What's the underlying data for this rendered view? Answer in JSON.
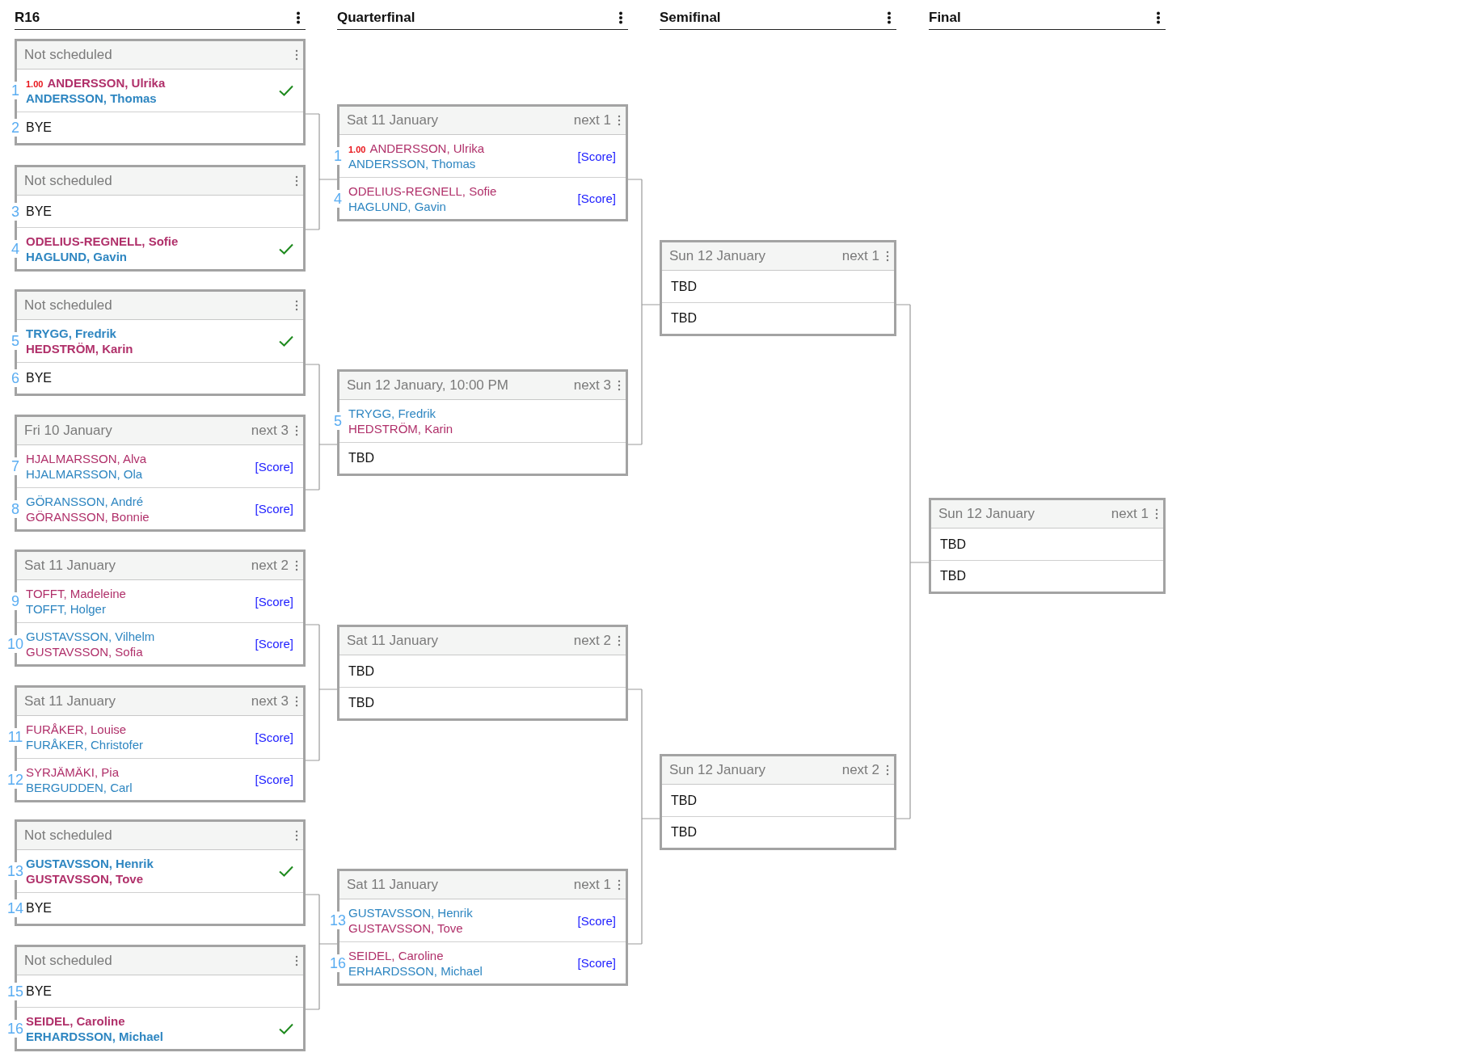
{
  "columns": [
    {
      "title": "R16",
      "matches": [
        {
          "date": "Not scheduled",
          "entries": [
            {
              "kind": "team",
              "seed": "1",
              "rating": "1.00",
              "winner": true,
              "players": [
                {
                  "name": "ANDERSSON, Ulrika",
                  "color": "#b0306a"
                },
                {
                  "name": "ANDERSSON, Thomas",
                  "color": "#2e86c1"
                }
              ]
            },
            {
              "kind": "bye",
              "seed": "2",
              "label": "BYE"
            }
          ]
        },
        {
          "date": "Not scheduled",
          "entries": [
            {
              "kind": "bye",
              "seed": "3",
              "label": "BYE"
            },
            {
              "kind": "team",
              "seed": "4",
              "winner": true,
              "players": [
                {
                  "name": "ODELIUS-REGNELL, Sofie",
                  "color": "#b0306a"
                },
                {
                  "name": "HAGLUND, Gavin",
                  "color": "#2e86c1"
                }
              ]
            }
          ]
        },
        {
          "date": "Not scheduled",
          "entries": [
            {
              "kind": "team",
              "seed": "5",
              "winner": true,
              "players": [
                {
                  "name": "TRYGG, Fredrik",
                  "color": "#2e86c1"
                },
                {
                  "name": "HEDSTRÖM, Karin",
                  "color": "#b0306a"
                }
              ]
            },
            {
              "kind": "bye",
              "seed": "6",
              "label": "BYE"
            }
          ]
        },
        {
          "date": "Fri 10 January",
          "next": "next 3",
          "entries": [
            {
              "kind": "team",
              "seed": "7",
              "winner": false,
              "score": "[Score]",
              "players": [
                {
                  "name": "HJALMARSSON, Alva",
                  "color": "#b0306a"
                },
                {
                  "name": "HJALMARSSON, Ola",
                  "color": "#2e86c1"
                }
              ]
            },
            {
              "kind": "team",
              "seed": "8",
              "winner": false,
              "score": "[Score]",
              "players": [
                {
                  "name": "GÖRANSSON, André",
                  "color": "#2e86c1"
                },
                {
                  "name": "GÖRANSSON, Bonnie",
                  "color": "#b0306a"
                }
              ]
            }
          ]
        },
        {
          "date": "Sat 11 January",
          "next": "next 2",
          "entries": [
            {
              "kind": "team",
              "seed": "9",
              "winner": false,
              "score": "[Score]",
              "players": [
                {
                  "name": "TOFFT, Madeleine",
                  "color": "#b0306a"
                },
                {
                  "name": "TOFFT, Holger",
                  "color": "#2e86c1"
                }
              ]
            },
            {
              "kind": "team",
              "seed": "10",
              "winner": false,
              "score": "[Score]",
              "players": [
                {
                  "name": "GUSTAVSSON, Vilhelm",
                  "color": "#2e86c1"
                },
                {
                  "name": "GUSTAVSSON, Sofia",
                  "color": "#b0306a"
                }
              ]
            }
          ]
        },
        {
          "date": "Sat 11 January",
          "next": "next 3",
          "entries": [
            {
              "kind": "team",
              "seed": "11",
              "winner": false,
              "score": "[Score]",
              "players": [
                {
                  "name": "FURÅKER, Louise",
                  "color": "#b0306a"
                },
                {
                  "name": "FURÅKER, Christofer",
                  "color": "#2e86c1"
                }
              ]
            },
            {
              "kind": "team",
              "seed": "12",
              "winner": false,
              "score": "[Score]",
              "players": [
                {
                  "name": "SYRJÄMÄKI, Pia",
                  "color": "#b0306a"
                },
                {
                  "name": "BERGUDDEN, Carl",
                  "color": "#2e86c1"
                }
              ]
            }
          ]
        },
        {
          "date": "Not scheduled",
          "entries": [
            {
              "kind": "team",
              "seed": "13",
              "winner": true,
              "players": [
                {
                  "name": "GUSTAVSSON, Henrik",
                  "color": "#2e86c1"
                },
                {
                  "name": "GUSTAVSSON, Tove",
                  "color": "#b0306a"
                }
              ]
            },
            {
              "kind": "bye",
              "seed": "14",
              "label": "BYE"
            }
          ]
        },
        {
          "date": "Not scheduled",
          "entries": [
            {
              "kind": "bye",
              "seed": "15",
              "label": "BYE"
            },
            {
              "kind": "team",
              "seed": "16",
              "winner": true,
              "players": [
                {
                  "name": "SEIDEL, Caroline",
                  "color": "#b0306a"
                },
                {
                  "name": "ERHARDSSON, Michael",
                  "color": "#2e86c1"
                }
              ]
            }
          ]
        }
      ]
    },
    {
      "title": "Quarterfinal",
      "matches": [
        {
          "date": "Sat 11 January",
          "next": "next 1",
          "entries": [
            {
              "kind": "team",
              "seed": "1",
              "rating": "1.00",
              "winner": false,
              "score": "[Score]",
              "players": [
                {
                  "name": "ANDERSSON, Ulrika",
                  "color": "#b0306a"
                },
                {
                  "name": "ANDERSSON, Thomas",
                  "color": "#2e86c1"
                }
              ]
            },
            {
              "kind": "team",
              "seed": "4",
              "winner": false,
              "score": "[Score]",
              "players": [
                {
                  "name": "ODELIUS-REGNELL, Sofie",
                  "color": "#b0306a"
                },
                {
                  "name": "HAGLUND, Gavin",
                  "color": "#2e86c1"
                }
              ]
            }
          ]
        },
        {
          "date": "Sun 12 January, 10:00 PM",
          "next": "next 3",
          "entries": [
            {
              "kind": "team",
              "seed": "5",
              "winner": false,
              "players": [
                {
                  "name": "TRYGG, Fredrik",
                  "color": "#2e86c1"
                },
                {
                  "name": "HEDSTRÖM, Karin",
                  "color": "#b0306a"
                }
              ]
            },
            {
              "kind": "tbd",
              "label": "TBD"
            }
          ]
        },
        {
          "date": "Sat 11 January",
          "next": "next 2",
          "entries": [
            {
              "kind": "tbd",
              "label": "TBD"
            },
            {
              "kind": "tbd",
              "label": "TBD"
            }
          ]
        },
        {
          "date": "Sat 11 January",
          "next": "next 1",
          "entries": [
            {
              "kind": "team",
              "seed": "13",
              "winner": false,
              "score": "[Score]",
              "players": [
                {
                  "name": "GUSTAVSSON, Henrik",
                  "color": "#2e86c1"
                },
                {
                  "name": "GUSTAVSSON, Tove",
                  "color": "#b0306a"
                }
              ]
            },
            {
              "kind": "team",
              "seed": "16",
              "winner": false,
              "score": "[Score]",
              "players": [
                {
                  "name": "SEIDEL, Caroline",
                  "color": "#b0306a"
                },
                {
                  "name": "ERHARDSSON, Michael",
                  "color": "#2e86c1"
                }
              ]
            }
          ]
        }
      ]
    },
    {
      "title": "Semifinal",
      "matches": [
        {
          "date": "Sun 12 January",
          "next": "next 1",
          "entries": [
            {
              "kind": "tbd",
              "label": "TBD"
            },
            {
              "kind": "tbd",
              "label": "TBD"
            }
          ]
        },
        {
          "date": "Sun 12 January",
          "next": "next 2",
          "entries": [
            {
              "kind": "tbd",
              "label": "TBD"
            },
            {
              "kind": "tbd",
              "label": "TBD"
            }
          ]
        }
      ]
    },
    {
      "title": "Final",
      "matches": [
        {
          "date": "Sun 12 January",
          "next": "next 1",
          "entries": [
            {
              "kind": "tbd",
              "label": "TBD"
            },
            {
              "kind": "tbd",
              "label": "TBD"
            }
          ]
        }
      ]
    }
  ]
}
